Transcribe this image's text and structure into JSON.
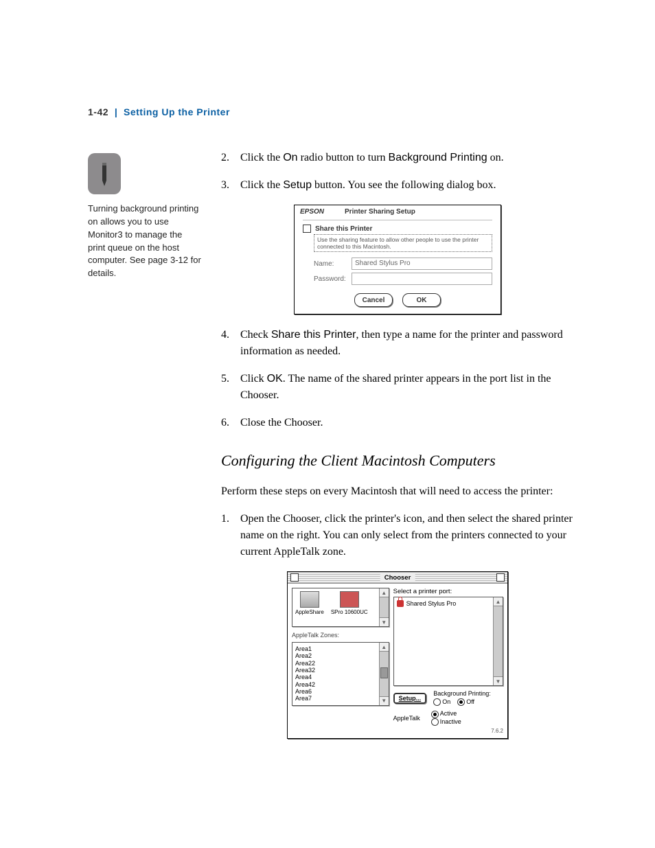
{
  "header": {
    "page_num": "1-42",
    "separator": "|",
    "section_title": "Setting Up the Printer"
  },
  "note": {
    "text": "Turning background printing on allows you to use Monitor3 to manage the print queue on the host computer. See page 3-12 for details."
  },
  "steps_a": [
    {
      "num": "2.",
      "pre": "Click the ",
      "bold1": "On",
      "mid": " radio button to turn ",
      "bold2": "Background Printing",
      "post": " on."
    },
    {
      "num": "3.",
      "pre": "Click the ",
      "bold1": "Setup",
      "mid": " button. You see the following dialog box.",
      "bold2": "",
      "post": ""
    }
  ],
  "dialog": {
    "brand": "EPSON",
    "title": "Printer Sharing Setup",
    "share_label": "Share this Printer",
    "hint": "Use the sharing feature to allow other people to use the printer connected to this Macintosh.",
    "name_label": "Name:",
    "name_value": "Shared Stylus Pro",
    "password_label": "Password:",
    "password_value": "",
    "cancel": "Cancel",
    "ok": "OK"
  },
  "steps_b": [
    {
      "num": "4.",
      "pre": "Check ",
      "bold1": "Share this Printer",
      "post": ", then type a name for the printer and password information as needed."
    },
    {
      "num": "5.",
      "pre": "Click ",
      "bold1": "OK",
      "post": ". The name of the shared printer appears in the port list in the Chooser."
    },
    {
      "num": "6.",
      "pre": "Close the Chooser.",
      "bold1": "",
      "post": ""
    }
  ],
  "subhead": "Configuring the Client Macintosh Computers",
  "intro": "Perform these steps on every Macintosh that will need to access the printer:",
  "steps_c": [
    {
      "num": "1.",
      "text": "Open the Chooser, click the printer's icon, and then select the shared printer name on the right. You can only select from the printers connected to your current AppleTalk zone."
    }
  ],
  "chooser": {
    "title": "Chooser",
    "printers": [
      {
        "name": "AppleShare"
      },
      {
        "name": "SPro 10600UC"
      }
    ],
    "zones_label": "AppleTalk Zones:",
    "zones": [
      "Area1",
      "Area2",
      "Area22",
      "Area32",
      "Area4",
      "Area42",
      "Area6",
      "Area7"
    ],
    "port_label": "Select a printer port:",
    "ports": [
      "Shared Stylus Pro"
    ],
    "setup_btn": "Setup...",
    "bgprint_label": "Background Printing:",
    "on": "On",
    "off": "Off",
    "bgprint_selected": "Off",
    "appletalk_label": "AppleTalk",
    "active": "Active",
    "inactive": "Inactive",
    "appletalk_selected": "Active",
    "version": "7.6.2"
  }
}
